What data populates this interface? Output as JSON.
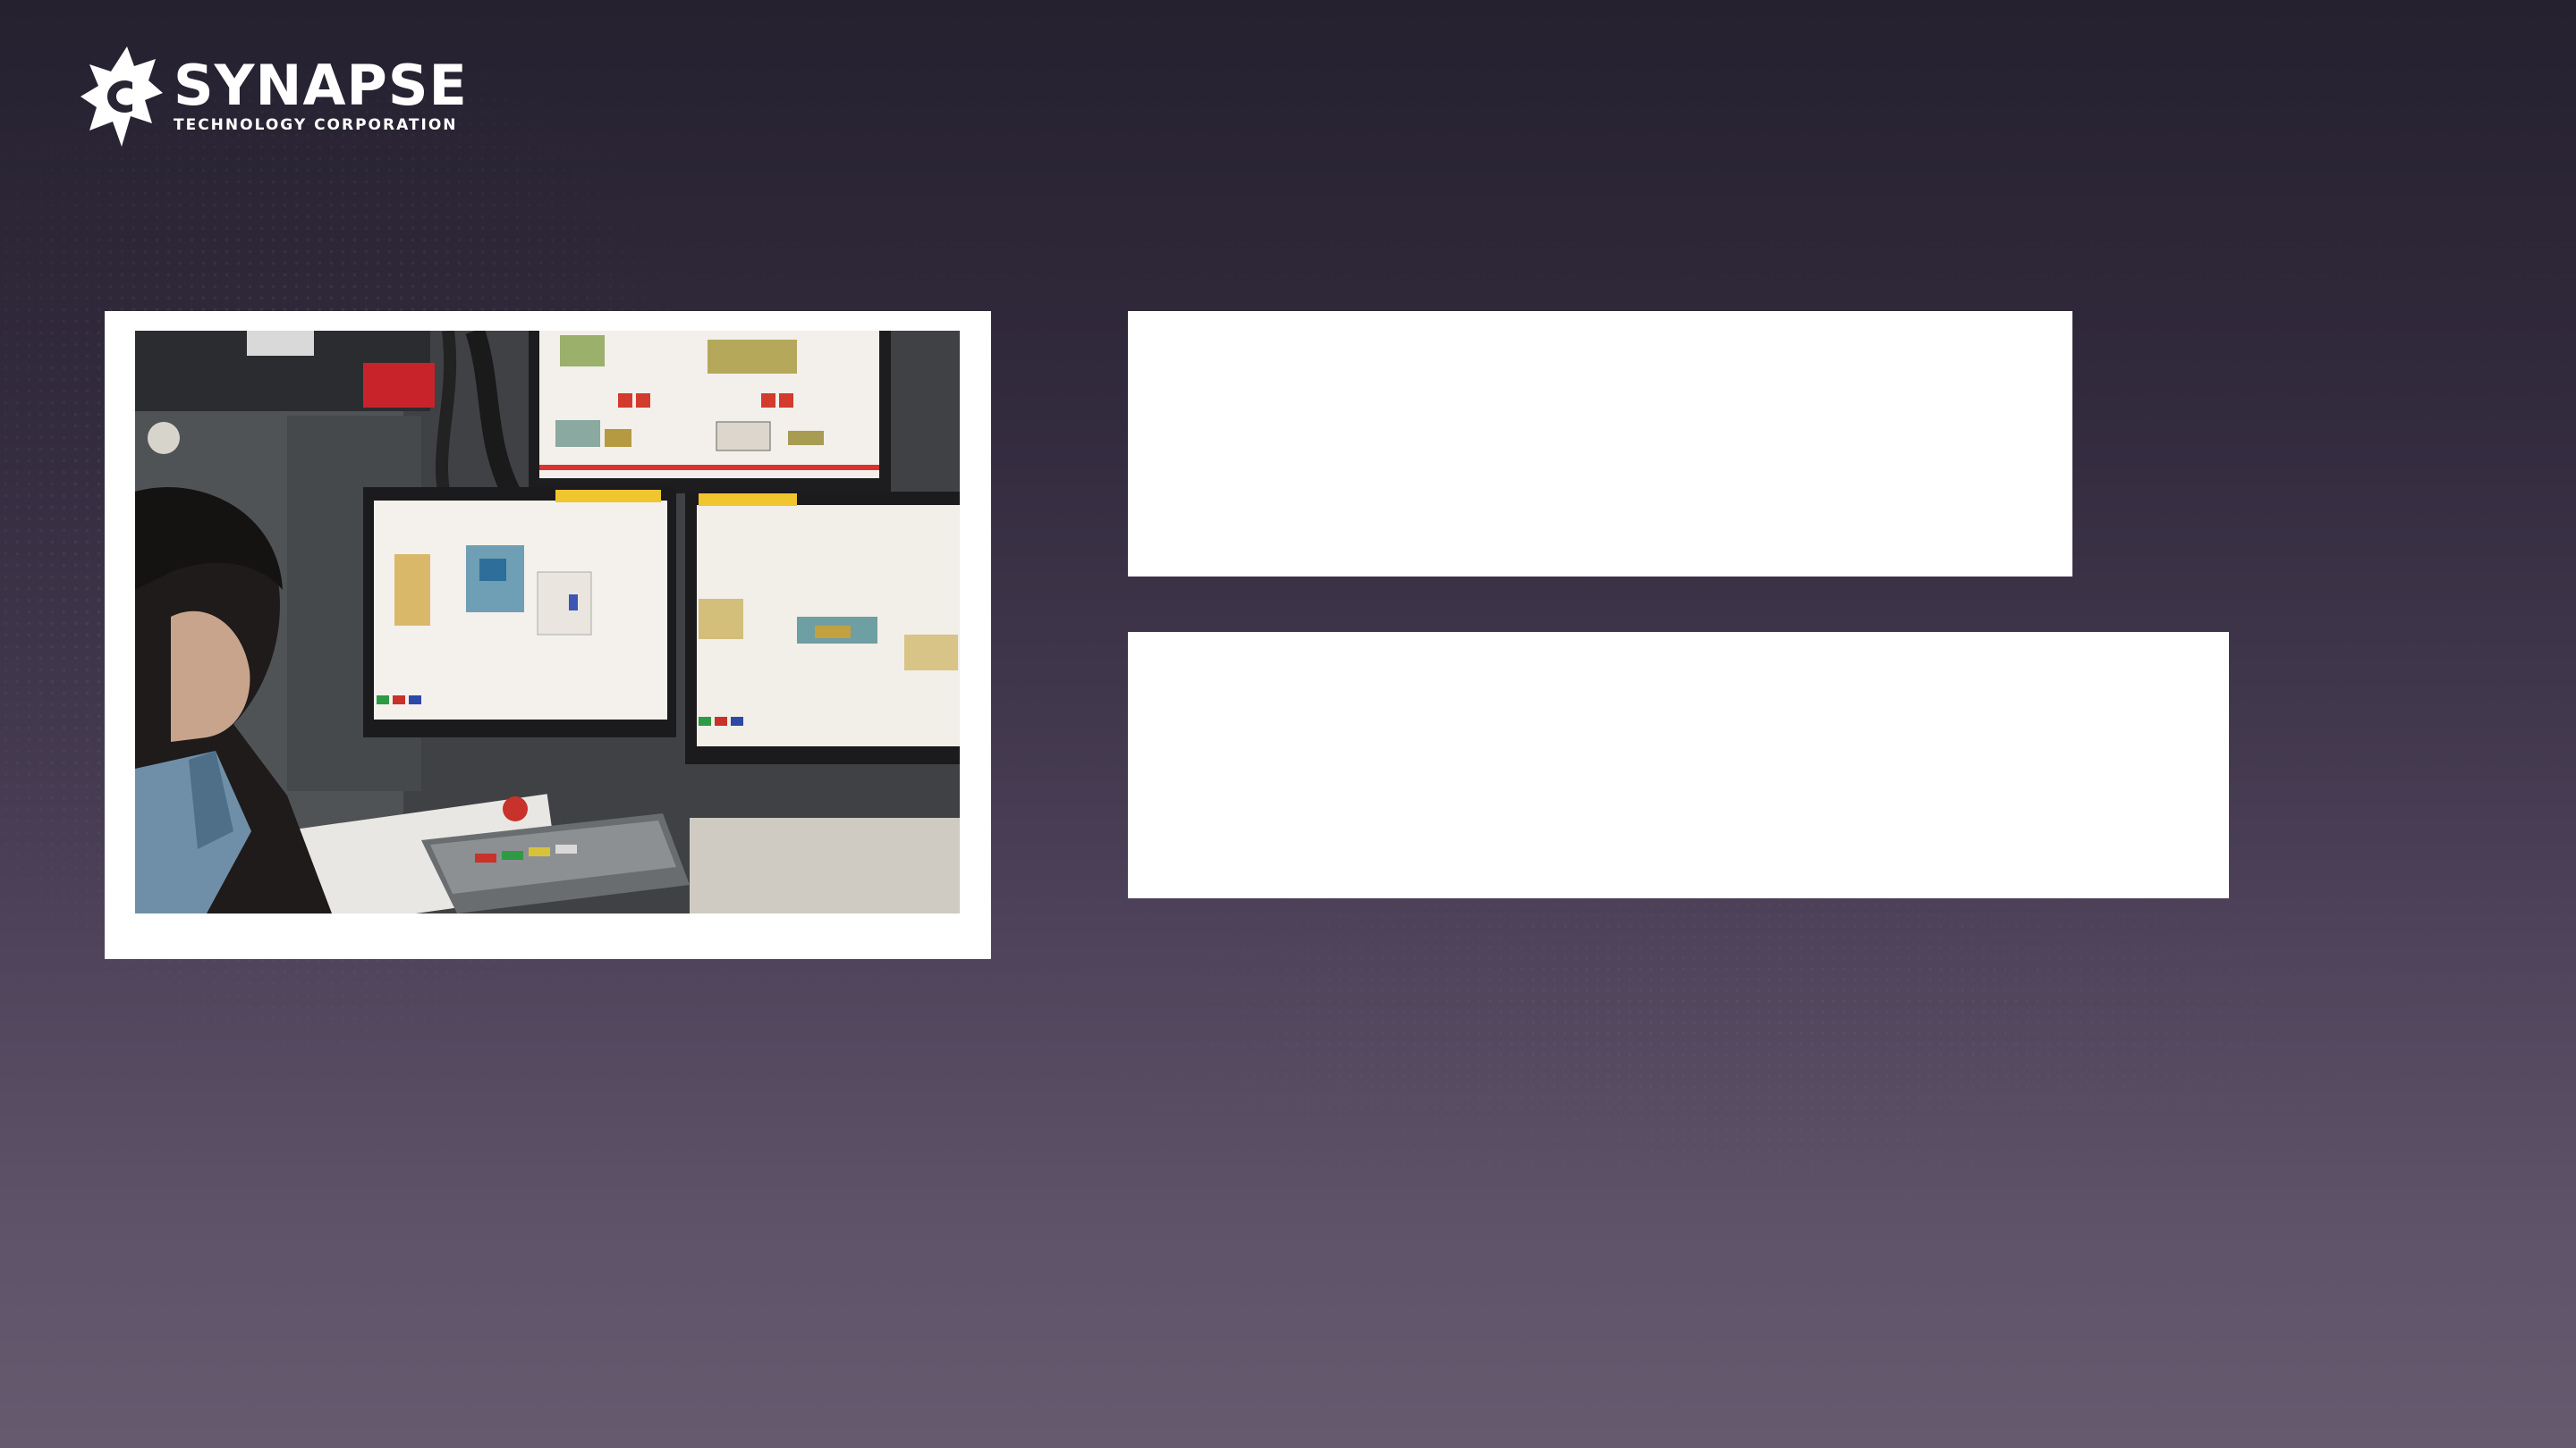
{
  "brand": {
    "name": "SYNAPSE",
    "subtitle": "TECHNOLOGY CORPORATION",
    "logo_icon": "synapse-logo-icon"
  },
  "colors": {
    "background_top": "#25212f",
    "background_bottom": "#665a6f",
    "panel": "#ffffff",
    "frame": "#ffffff"
  },
  "photo": {
    "subject": "operator viewing x-ray baggage screening monitors"
  },
  "panels": [
    {
      "text": ""
    },
    {
      "text": ""
    }
  ]
}
